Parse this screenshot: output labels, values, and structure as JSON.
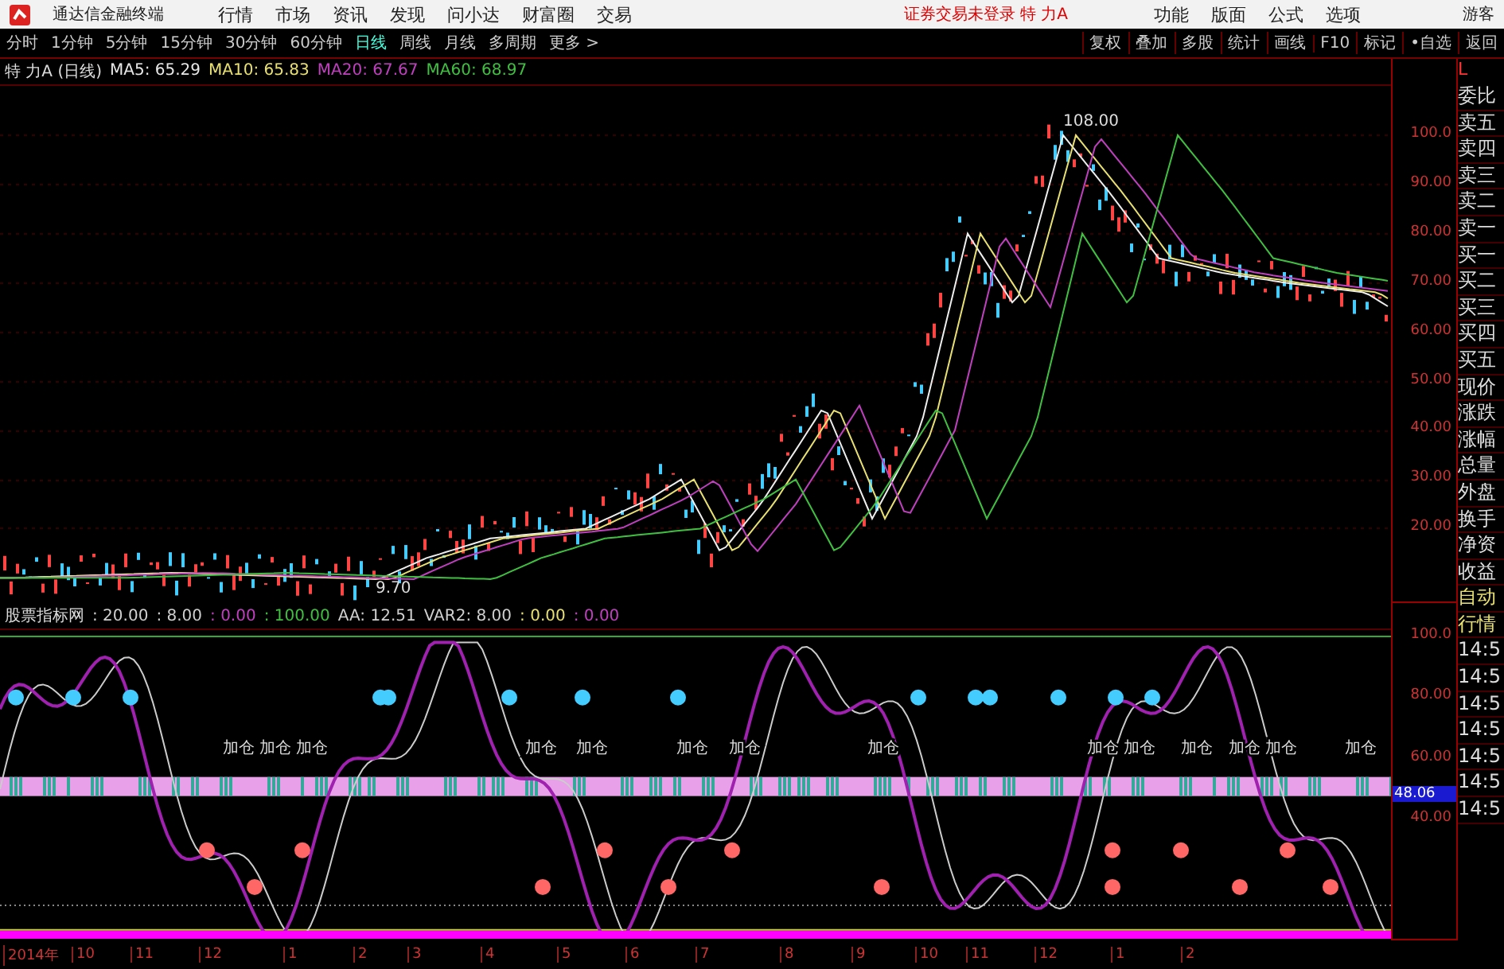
{
  "title_bar": {
    "app_name": "通达信金融终端",
    "menu": [
      "行情",
      "市场",
      "资讯",
      "发现",
      "问小达",
      "财富圈",
      "交易"
    ],
    "notice": "证券交易未登录  特 力A",
    "tools": [
      "功能",
      "版面",
      "公式",
      "选项"
    ],
    "guest": "游客"
  },
  "periods": [
    {
      "label": "分时",
      "selected": false
    },
    {
      "label": "1分钟",
      "selected": false
    },
    {
      "label": "5分钟",
      "selected": false
    },
    {
      "label": "15分钟",
      "selected": false
    },
    {
      "label": "30分钟",
      "selected": false
    },
    {
      "label": "60分钟",
      "selected": false
    },
    {
      "label": "日线",
      "selected": true
    },
    {
      "label": "周线",
      "selected": false
    },
    {
      "label": "月线",
      "selected": false
    },
    {
      "label": "多周期",
      "selected": false
    },
    {
      "label": "更多 >",
      "selected": false
    }
  ],
  "right_tools": [
    "复权",
    "叠加",
    "多股",
    "统计",
    "画线",
    "F10",
    "标记",
    "•自选",
    "返回"
  ],
  "price_panel": {
    "title": "特 力A (日线)",
    "ma": [
      {
        "label": "MA5: 65.29",
        "color": "#e8e8e8"
      },
      {
        "label": "MA10: 65.83",
        "color": "#e8e070"
      },
      {
        "label": "MA20: 67.67",
        "color": "#c040c0"
      },
      {
        "label": "MA60: 68.97",
        "color": "#40c040"
      }
    ],
    "yaxis": [
      "100.0",
      "90.00",
      "80.00",
      "70.00",
      "60.00",
      "50.00",
      "40.00",
      "30.00",
      "20.00"
    ],
    "high_label": "108.00",
    "low_label": "9.70"
  },
  "indicator": {
    "name": "股票指标网",
    "values": [
      {
        "text": ": 20.00",
        "color": "#d0d0d0"
      },
      {
        "text": ": 8.00",
        "color": "#d0d0d0"
      },
      {
        "text": ": 0.00",
        "color": "#c040c0"
      },
      {
        "text": ": 100.00",
        "color": "#40c040"
      },
      {
        "text": "AA: 12.51",
        "color": "#d0d0d0"
      },
      {
        "text": "VAR2: 8.00",
        "color": "#d0d0d0"
      },
      {
        "text": ": 0.00",
        "color": "#e8e070"
      },
      {
        "text": ": 0.00",
        "color": "#c040c0"
      }
    ],
    "yaxis": [
      "100.0",
      "80.00",
      "60.00",
      "40.00"
    ],
    "current": "48.06",
    "add_labels": [
      "加仓",
      "加仓",
      "加仓",
      "加仓",
      "加仓",
      "加仓",
      "加仓",
      "加仓",
      "加仓",
      "加仓",
      "加仓",
      "加仓",
      "加仓",
      "加仓"
    ]
  },
  "side_header": "L",
  "quote_fields": [
    "委比",
    "卖五",
    "卖四",
    "卖三",
    "卖二",
    "卖一",
    "买一",
    "买二",
    "买三",
    "买四",
    "买五",
    "现价",
    "涨跌",
    "涨幅",
    "总量",
    "外盘",
    "换手",
    "净资",
    "收益",
    "自动",
    "行情"
  ],
  "ticks": [
    "14:5",
    "14:5",
    "14:5",
    "14:5",
    "14:5",
    "14:5",
    "14:5"
  ],
  "time_axis": [
    "2014年",
    "10",
    "11",
    "12",
    "1",
    "2",
    "3",
    "4",
    "5",
    "6",
    "7",
    "8",
    "9",
    "10",
    "11",
    "12",
    "1",
    "2"
  ]
}
